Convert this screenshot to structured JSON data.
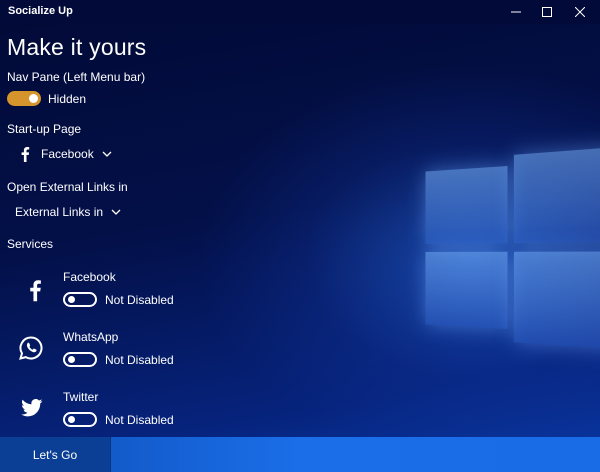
{
  "window": {
    "title": "Socialize Up"
  },
  "page": {
    "heading": "Make it yours"
  },
  "nav_pane": {
    "label": "Nav Pane (Left Menu bar)",
    "toggle_state": "on",
    "toggle_text": "Hidden"
  },
  "startup": {
    "label": "Start-up Page",
    "selected": "Facebook",
    "icon": "facebook-icon"
  },
  "external_links": {
    "label": "Open External Links in",
    "selected": "External Links in"
  },
  "services": {
    "label": "Services",
    "items": [
      {
        "name": "Facebook",
        "status": "Not Disabled",
        "icon": "facebook-icon",
        "toggle_state": "off"
      },
      {
        "name": "WhatsApp",
        "status": "Not Disabled",
        "icon": "whatsapp-icon",
        "toggle_state": "off"
      },
      {
        "name": "Twitter",
        "status": "Not Disabled",
        "icon": "twitter-icon",
        "toggle_state": "off"
      }
    ]
  },
  "footer": {
    "go_label": "Let's Go"
  },
  "colors": {
    "accent": "#d5942c",
    "background": "#020a3a",
    "footer": "#1b6ee8",
    "go_button": "#0b3f95"
  }
}
